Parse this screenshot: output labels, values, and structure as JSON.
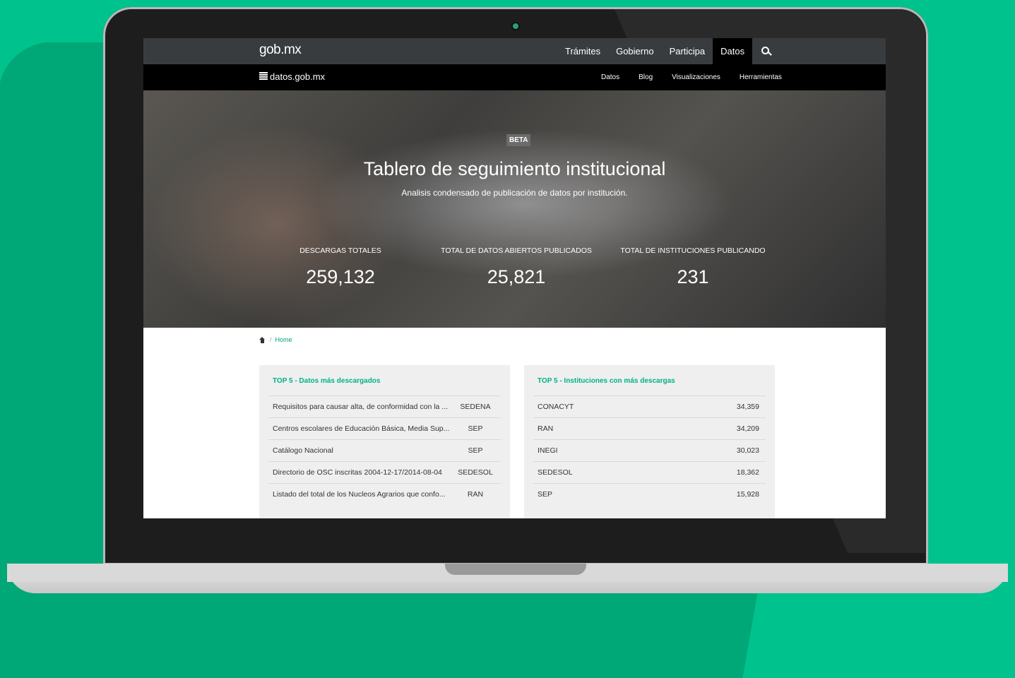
{
  "topbar": {
    "logo": "gob.mx",
    "nav": [
      "Trámites",
      "Gobierno",
      "Participa",
      "Datos"
    ],
    "active": "Datos"
  },
  "subbar": {
    "logo": "datos.gob.mx",
    "nav": [
      "Datos",
      "Blog",
      "Visualizaciones",
      "Herramientas"
    ]
  },
  "hero": {
    "badge": "BETA",
    "title": "Tablero de seguimiento institucional",
    "subtitle": "Analisis condensado de publicación de datos por institución.",
    "stats": [
      {
        "label": "DESCARGAS TOTALES",
        "value": "259,132"
      },
      {
        "label": "TOTAL DE DATOS ABIERTOS PUBLICADOS",
        "value": "25,821"
      },
      {
        "label": "TOTAL DE INSTITUCIONES PUBLICANDO",
        "value": "231"
      }
    ]
  },
  "breadcrumb": {
    "home": "Home"
  },
  "top_datasets": {
    "title": "TOP 5 - Datos más descargados",
    "rows": [
      {
        "name": "Requisitos para causar alta, de conformidad con la ...",
        "org": "SEDENA"
      },
      {
        "name": "Centros escolares de Educación Básica, Media Sup...",
        "org": "SEP"
      },
      {
        "name": "Catálogo Nacional",
        "org": "SEP"
      },
      {
        "name": "Directorio de OSC inscritas 2004-12-17/2014-08-04",
        "org": "SEDESOL"
      },
      {
        "name": "Listado del total de los Nucleos Agrarios que confo...",
        "org": "RAN"
      }
    ]
  },
  "top_institutions": {
    "title": "TOP 5 - Instituciones con más descargas",
    "rows": [
      {
        "name": "CONACYT",
        "downloads": "34,359"
      },
      {
        "name": "RAN",
        "downloads": "34,209"
      },
      {
        "name": "INEGI",
        "downloads": "30,023"
      },
      {
        "name": "SEDESOL",
        "downloads": "18,362"
      },
      {
        "name": "SEP",
        "downloads": "15,928"
      }
    ]
  },
  "colors": {
    "accent": "#00b383",
    "background": "#00c28c",
    "topbar": "#393c3f"
  }
}
